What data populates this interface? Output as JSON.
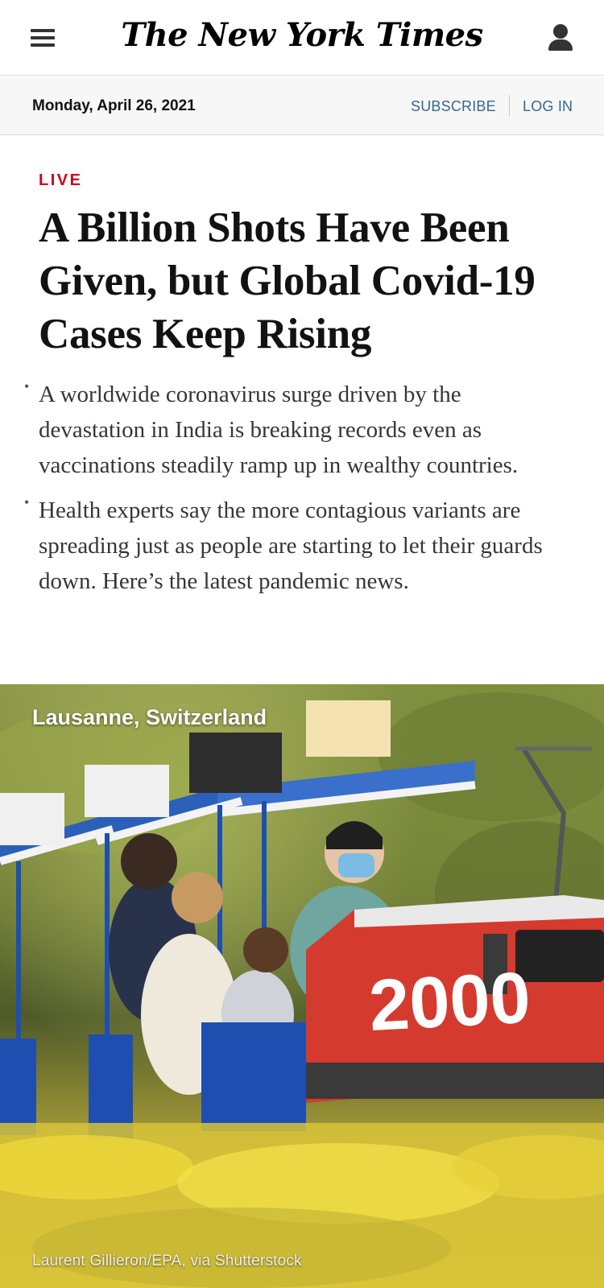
{
  "header": {
    "logo_text": "The New York Times",
    "menu_icon": "hamburger-menu-icon",
    "account_icon": "user-account-icon"
  },
  "subheader": {
    "date": "Monday, April 26, 2021",
    "subscribe_label": "SUBSCRIBE",
    "login_label": "LOG IN"
  },
  "article": {
    "kicker": "LIVE",
    "headline": "A Billion Shots Have Been Given, but Global Covid-19 Cases Keep Rising",
    "summary": [
      "A worldwide coronavirus surge driven by the devastation in India is breaking records even as vaccinations steadily ramp up in wealthy countries.",
      "Health experts say the more contagious variants are spreading just as people are starting to let their guards down. Here’s the latest pandemic news."
    ]
  },
  "photo": {
    "location": "Lausanne, Switzerland",
    "credit": "Laurent Gillieron/EPA, via Shutterstock",
    "train_number": "2000"
  },
  "colors": {
    "live_red": "#d0021b",
    "link_blue": "#326891",
    "datebar_bg": "#f7f7f7"
  }
}
